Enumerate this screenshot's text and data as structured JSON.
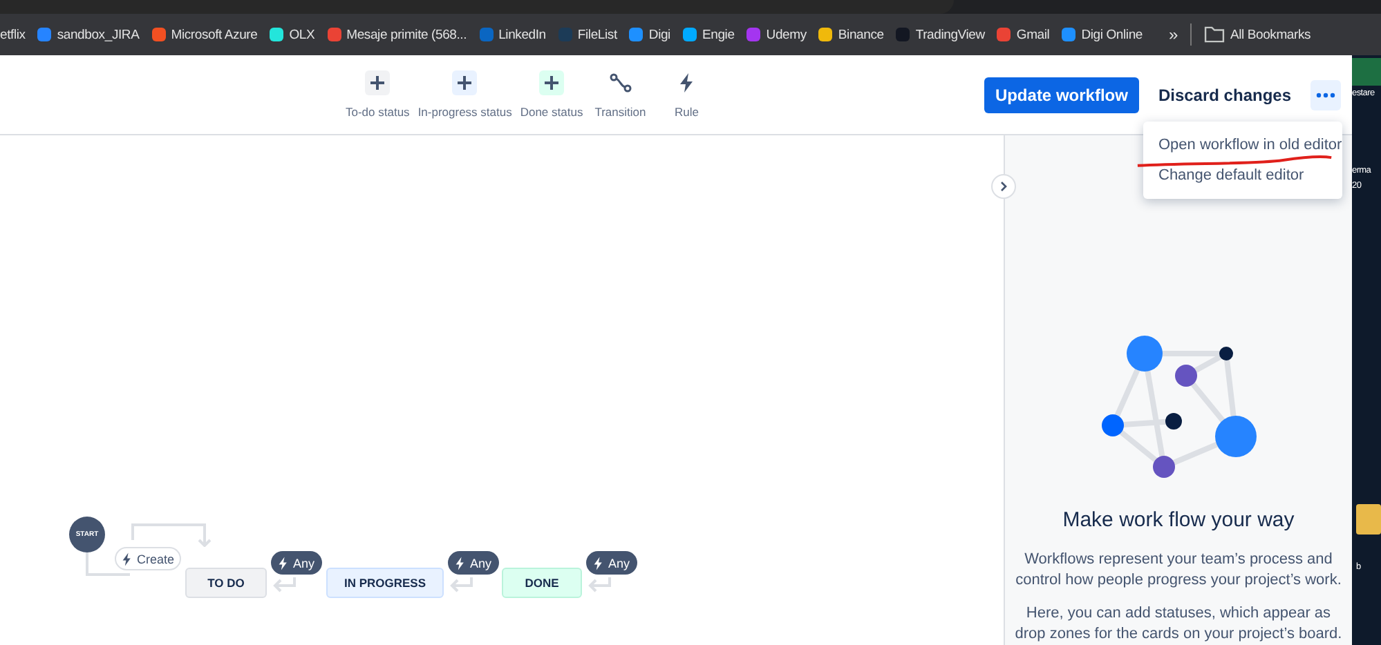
{
  "browser": {
    "bookmarks": [
      {
        "label": "etflix"
      },
      {
        "label": "sandbox_JIRA",
        "color": "#2684ff"
      },
      {
        "label": "Microsoft Azure",
        "color": "#f25022"
      },
      {
        "label": "OLX",
        "color": "#23e5db"
      },
      {
        "label": "Mesaje primite (568...",
        "color": "#ea4335"
      },
      {
        "label": "LinkedIn",
        "color": "#0a66c2"
      },
      {
        "label": "FileList",
        "color": "#1c3b57"
      },
      {
        "label": "Digi",
        "color": "#1e90ff"
      },
      {
        "label": "Engie",
        "color": "#00aaff"
      },
      {
        "label": "Udemy",
        "color": "#a435f0"
      },
      {
        "label": "Binance",
        "color": "#f0b90b"
      },
      {
        "label": "TradingView",
        "color": "#131722"
      },
      {
        "label": "Gmail",
        "color": "#ea4335"
      },
      {
        "label": "Digi Online",
        "color": "#1e90ff"
      }
    ],
    "overflow": "»",
    "all_bookmarks": "All Bookmarks"
  },
  "toolbar": {
    "items": [
      {
        "kind": "status",
        "label": "To-do status",
        "color": "#f1f2f4"
      },
      {
        "kind": "status",
        "label": "In-progress status",
        "color": "#e9f2ff"
      },
      {
        "kind": "status",
        "label": "Done status",
        "color": "#dcfff1"
      },
      {
        "kind": "transition",
        "label": "Transition"
      },
      {
        "kind": "rule",
        "label": "Rule"
      }
    ],
    "primary": "Update workflow",
    "secondary": "Discard changes"
  },
  "menu": {
    "expanded": true,
    "items": [
      "Open workflow in old editor",
      "Change default editor"
    ]
  },
  "diagram": {
    "start": "START",
    "create": "Create",
    "statuses": [
      {
        "label": "TO DO",
        "color": "#f1f2f4",
        "any": "Any"
      },
      {
        "label": "IN PROGRESS",
        "color": "#e9f2ff",
        "any": "Any"
      },
      {
        "label": "DONE",
        "color": "#dcfff1",
        "any": "Any"
      }
    ]
  },
  "panel": {
    "title": "Make work flow your way",
    "paragraphs": [
      "Workflows represent your team’s process and control how people progress your project’s work.",
      "Here, you can add statuses, which appear as drop zones for the cards on your project’s board."
    ]
  },
  "desktop": {
    "labels": [
      "estare",
      "erma",
      "20",
      "b"
    ]
  }
}
